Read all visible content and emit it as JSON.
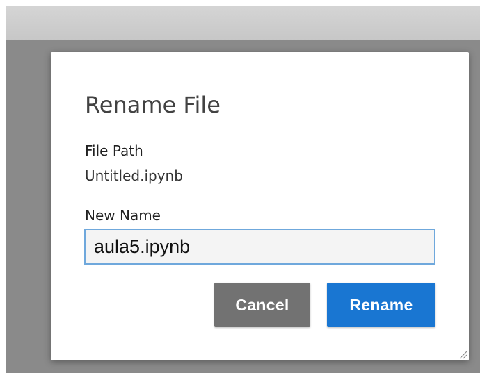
{
  "dialog": {
    "title": "Rename File",
    "file_path_label": "File Path",
    "file_path_value": "Untitled.ipynb",
    "new_name_label": "New Name",
    "new_name_value": "aula5.ipynb",
    "cancel_label": "Cancel",
    "rename_label": "Rename"
  },
  "colors": {
    "primary": "#1976d2",
    "secondary": "#727272",
    "input_border": "#6fa8dc"
  },
  "icons": {
    "resize": "resize-grip-icon"
  }
}
